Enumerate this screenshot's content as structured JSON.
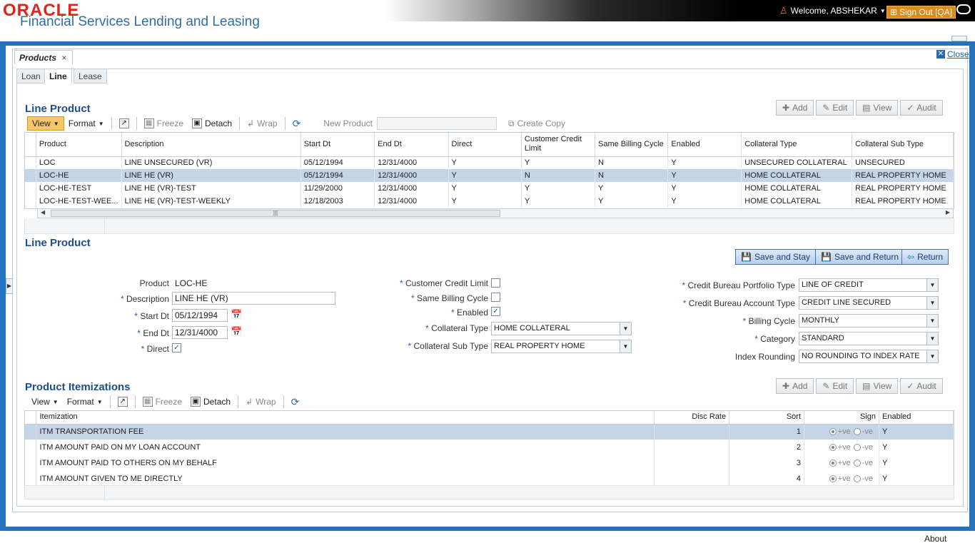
{
  "header": {
    "logo": "ORACLE",
    "app_title": "Financial Services Lending and Leasing",
    "welcome": "Welcome, ABSHEKAR",
    "sign_out": "Sign Out [QA]"
  },
  "doc_tab": {
    "label": "Products",
    "close_x": "×"
  },
  "close_label": "Close",
  "subtabs": [
    "Loan",
    "Line",
    "Lease"
  ],
  "line_product": {
    "title": "Line Product",
    "actions": [
      "Add",
      "Edit",
      "View",
      "Audit"
    ],
    "toolbar": {
      "view": "View",
      "format": "Format",
      "freeze": "Freeze",
      "detach": "Detach",
      "wrap": "Wrap",
      "new_product": "New Product",
      "create_copy": "Create Copy"
    },
    "columns": [
      "Product",
      "Description",
      "Start Dt",
      "End Dt",
      "Direct",
      "Customer Credit Limit",
      "Same Billing Cycle",
      "Enabled",
      "Collateral Type",
      "Collateral Sub Type"
    ],
    "rows": [
      [
        "LOC",
        "LINE UNSECURED (VR)",
        "05/12/1994",
        "12/31/4000",
        "Y",
        "Y",
        "N",
        "Y",
        "UNSECURED COLLATERAL",
        "UNSECURED"
      ],
      [
        "LOC-HE",
        "LINE HE (VR)",
        "05/12/1994",
        "12/31/4000",
        "Y",
        "N",
        "N",
        "Y",
        "HOME COLLATERAL",
        "REAL PROPERTY HOME"
      ],
      [
        "LOC-HE-TEST",
        "LINE HE (VR)-TEST",
        "11/29/2000",
        "12/31/4000",
        "Y",
        "Y",
        "Y",
        "Y",
        "HOME COLLATERAL",
        "REAL PROPERTY HOME"
      ],
      [
        "LOC-HE-TEST-WEE...",
        "LINE HE (VR)-TEST-WEEKLY",
        "12/18/2003",
        "12/31/4000",
        "Y",
        "Y",
        "Y",
        "Y",
        "HOME COLLATERAL",
        "REAL PROPERTY HOME"
      ]
    ],
    "selected_row": 1
  },
  "form": {
    "title": "Line Product",
    "buttons": {
      "save_stay": "Save and Stay",
      "save_return": "Save and Return",
      "return": "Return"
    },
    "product_label": "Product",
    "product_value": "LOC-HE",
    "description_label": "Description",
    "description_value": "LINE HE (VR)",
    "start_dt_label": "Start Dt",
    "start_dt_value": "05/12/1994",
    "end_dt_label": "End Dt",
    "end_dt_value": "12/31/4000",
    "direct_label": "Direct",
    "ccl_label": "Customer Credit Limit",
    "sbc_label": "Same Billing Cycle",
    "enabled_label": "Enabled",
    "coll_type_label": "Collateral Type",
    "coll_type_value": "HOME COLLATERAL",
    "coll_sub_label": "Collateral Sub Type",
    "coll_sub_value": "REAL PROPERTY HOME",
    "cbpt_label": "Credit Bureau Portfolio Type",
    "cbpt_value": "LINE OF CREDIT",
    "cbat_label": "Credit Bureau Account Type",
    "cbat_value": "CREDIT LINE SECURED",
    "billing_label": "Billing Cycle",
    "billing_value": "MONTHLY",
    "category_label": "Category",
    "category_value": "STANDARD",
    "rounding_label": "Index Rounding",
    "rounding_value": "NO ROUNDING TO INDEX RATE",
    "required_mark": "*",
    "check_mark": "✓"
  },
  "itemizations": {
    "title": "Product Itemizations",
    "actions": [
      "Add",
      "Edit",
      "View",
      "Audit"
    ],
    "toolbar": {
      "view": "View",
      "format": "Format",
      "freeze": "Freeze",
      "detach": "Detach",
      "wrap": "Wrap"
    },
    "columns": {
      "itemization": "Itemization",
      "disc_rate": "Disc Rate",
      "sort": "Sort",
      "sign": "Sign",
      "enabled": "Enabled"
    },
    "sign_pos": "+ve",
    "sign_neg": "-ve",
    "rows": [
      {
        "name": "ITM TRANSPORTATION FEE",
        "disc": "",
        "sort": "1",
        "enabled": "Y"
      },
      {
        "name": "ITM AMOUNT PAID ON MY LOAN ACCOUNT",
        "disc": "",
        "sort": "2",
        "enabled": "Y"
      },
      {
        "name": "ITM AMOUNT PAID TO OTHERS ON MY BEHALF",
        "disc": "",
        "sort": "3",
        "enabled": "Y"
      },
      {
        "name": "ITM AMOUNT GIVEN TO ME DIRECTLY",
        "disc": "",
        "sort": "4",
        "enabled": "Y"
      }
    ],
    "selected_row": 0
  },
  "footer": {
    "about": "About"
  }
}
